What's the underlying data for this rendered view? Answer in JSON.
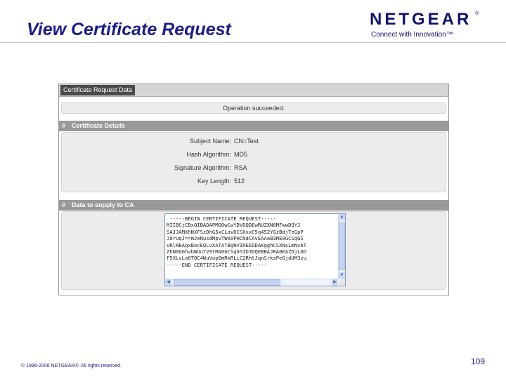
{
  "slide": {
    "title": "View Certificate Request",
    "footer": "© 1996-2006 NETGEAR®. All rights reserved.",
    "page_number": "109"
  },
  "logo": {
    "wordmark": "NETGEAR",
    "registered": "®",
    "tagline": "Connect with Innovation™",
    "color": "#12126e"
  },
  "panel": {
    "tab_label": "Certificate Request Data",
    "status_message": "Operation succeeded.",
    "details": {
      "section_title": "Certificate Details",
      "bullet": "#",
      "rows": [
        {
          "label": "Subject Name:",
          "value": "CN=Test"
        },
        {
          "label": "Hash Algorithm:",
          "value": "MD5"
        },
        {
          "label": "Signature Algorithm:",
          "value": "RSA"
        },
        {
          "label": "Key Length:",
          "value": "512"
        }
      ]
    },
    "supply": {
      "section_title": "Data to supply to CA",
      "bullet": "#",
      "lines": [
        " -----BEGIN CERTIFICATE REQUEST-----",
        "MIIBCjCBxQIBADAPMQ0wCwYDVQQDEwRUZXN0MFwwDQYJ",
        "SAJJAMXhNXFSzDhG5xCLavDCS0xxC5q452YGzBdjTeGpP",
        "J0rUqJ==mJeNusdMpvTWo0PHCNdCAvEAAaB3ME0GCSqGS",
        "VRlRBAgxBocEQLvXATATBgNVIREEDDAKgghCSXNsLmNvbT",
        "ZhN0QGhvbWUuY29tMA0GCSqGSIb3DQEBBAJRA0EAZDjLOD",
        "F5XLvLa0TOC4WuVopOmRkRLiC2RhtJqnSrksPeQjdUM3zu",
        "-----END CERTIFICATE REQUEST-----"
      ]
    }
  }
}
